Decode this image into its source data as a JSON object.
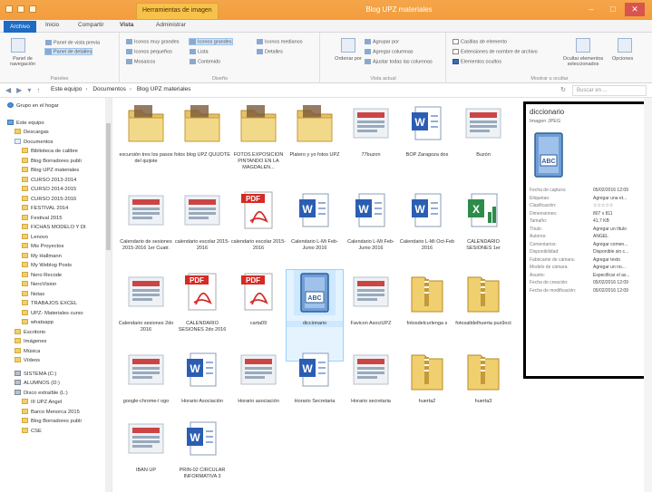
{
  "window": {
    "title": "Blog UPZ materiales",
    "context_tab": "Herramientas de imagen",
    "controls": [
      "–",
      "□",
      "✕"
    ]
  },
  "ribbon_tabs": [
    "Archivo",
    "Inicio",
    "Compartir",
    "Vista",
    "Administrar"
  ],
  "ribbon": {
    "panes": {
      "nav_pane": "Panel de navegación",
      "preview_pane": "Panel de vista previa",
      "details_pane": "Panel de detalles",
      "label": "Paneles"
    },
    "layout": {
      "items": [
        "Iconos muy grandes",
        "Iconos grandes",
        "Iconos medianos",
        "Iconos pequeños",
        "Lista",
        "Detalles",
        "Mosaicos",
        "Contenido"
      ],
      "label": "Diseño"
    },
    "current_view": {
      "sort": "Ordenar por",
      "group": "Agrupar por",
      "add_columns": "Agregar columnas",
      "fit_columns": "Ajustar todas las columnas",
      "label": "Vista actual"
    },
    "show_hide": {
      "checkboxes": "Casillas de elemento",
      "extensions": "Extensiones de nombre de archivo",
      "hidden": "Elementos ocultos",
      "hide_selected": "Ocultar elementos seleccionados",
      "options": "Opciones",
      "label": "Mostrar u ocultar"
    }
  },
  "address": {
    "crumbs": [
      "Este equipo",
      "Documentos",
      "Blog UPZ materiales"
    ],
    "search_placeholder": "Buscar en ...",
    "refresh": "↻"
  },
  "nav_items": [
    {
      "label": "Grupo en el hogar",
      "icon": "homegroup-icon",
      "indent": 0
    },
    {
      "label": "Este equipo",
      "icon": "computer-icon",
      "indent": 0
    },
    {
      "label": "Descargas",
      "icon": "folder-icon",
      "indent": 1
    },
    {
      "label": "Documentos",
      "icon": "documents-icon",
      "indent": 1
    },
    {
      "label": "Biblioteca de calibre",
      "icon": "folder-icon",
      "indent": 2
    },
    {
      "label": "Blog Borradores publi",
      "icon": "folder-icon",
      "indent": 2
    },
    {
      "label": "Blog UPZ materiales",
      "icon": "folder-icon",
      "indent": 2
    },
    {
      "label": "CURSO 2013-2014",
      "icon": "folder-icon",
      "indent": 2
    },
    {
      "label": "CURSO 2014-2015",
      "icon": "folder-icon",
      "indent": 2
    },
    {
      "label": "CURSO 2015-2016",
      "icon": "folder-icon",
      "indent": 2
    },
    {
      "label": "FESTIVAL 2014",
      "icon": "folder-icon",
      "indent": 2
    },
    {
      "label": "Festival 2015",
      "icon": "folder-icon",
      "indent": 2
    },
    {
      "label": "FICHAS MODELO Y DI",
      "icon": "folder-icon",
      "indent": 2
    },
    {
      "label": "Lenovo",
      "icon": "folder-icon",
      "indent": 2
    },
    {
      "label": "Mis Proyectos",
      "icon": "folder-icon",
      "indent": 2
    },
    {
      "label": "My Hallmann",
      "icon": "folder-icon",
      "indent": 2
    },
    {
      "label": "My Weblog Posts",
      "icon": "folder-icon",
      "indent": 2
    },
    {
      "label": "Nero Recode",
      "icon": "folder-icon",
      "indent": 2
    },
    {
      "label": "NeroVision",
      "icon": "folder-icon",
      "indent": 2
    },
    {
      "label": "Notas",
      "icon": "folder-icon",
      "indent": 2
    },
    {
      "label": "TRABAJOS EXCEL",
      "icon": "folder-icon",
      "indent": 2
    },
    {
      "label": "UPZ- Materiales curso",
      "icon": "folder-icon",
      "indent": 2
    },
    {
      "label": "whatsapp",
      "icon": "folder-icon",
      "indent": 2
    },
    {
      "label": "Escritorio",
      "icon": "folder-icon",
      "indent": 1
    },
    {
      "label": "Imágenes",
      "icon": "folder-icon",
      "indent": 1
    },
    {
      "label": "Música",
      "icon": "folder-icon",
      "indent": 1
    },
    {
      "label": "Vídeos",
      "icon": "folder-icon",
      "indent": 1
    },
    {
      "label": "SISTEMA (C:)",
      "icon": "drive-icon",
      "indent": 1
    },
    {
      "label": "ALUMNOS (D:)",
      "icon": "drive-icon",
      "indent": 1
    },
    {
      "label": "Disco extraíble (L:)",
      "icon": "drive-icon",
      "indent": 1
    },
    {
      "label": "III UPZ Angel",
      "icon": "folder-icon",
      "indent": 2
    },
    {
      "label": "Barco Menorca 2015",
      "icon": "folder-icon",
      "indent": 2
    },
    {
      "label": "Blog Borradores publi",
      "icon": "folder-icon",
      "indent": 2
    },
    {
      "label": "CSE",
      "icon": "folder-icon",
      "indent": 2
    }
  ],
  "files": [
    {
      "name": "excursión tres los pasos del quijote",
      "type": "folder"
    },
    {
      "name": "fotos blog UPZ QUIJOTE",
      "type": "folder"
    },
    {
      "name": "FOTOS EXPOSICION PINTANDO EN LA MAGDALEN...",
      "type": "folder"
    },
    {
      "name": "Platero y yo fotos UPZ",
      "type": "folder"
    },
    {
      "name": "77buzon",
      "type": "image"
    },
    {
      "name": "BOP Zaragoza dos",
      "type": "word"
    },
    {
      "name": "Buzón",
      "type": "image"
    },
    {
      "name": "Calendario de sesiones 2015-2016 1er Cuatr.",
      "type": "image"
    },
    {
      "name": "calendario escolar 2015-2016",
      "type": "image"
    },
    {
      "name": "calendario escolar 2015-2016",
      "type": "pdf"
    },
    {
      "name": "Calendario L-Mi Feb-Junio 2016",
      "type": "word"
    },
    {
      "name": "Calendario L-Mi Feb-Junio 2016",
      "type": "word"
    },
    {
      "name": "Calendario L-Mi Oct-Feb 2016",
      "type": "word"
    },
    {
      "name": "CALENDARIO SESIONES 1er",
      "type": "excel"
    },
    {
      "name": "Calendario sesiones 2do 2016",
      "type": "image"
    },
    {
      "name": "CALENDARIO SESIONES 2do 2016",
      "type": "pdf"
    },
    {
      "name": "carta09",
      "type": "pdf"
    },
    {
      "name": "diccionario",
      "type": "image-selected"
    },
    {
      "name": "Favicon AsociUPZ",
      "type": "image"
    },
    {
      "name": "fotosdelcurlenga s",
      "type": "zip"
    },
    {
      "name": "fotosaltdelhuerta pus9oct",
      "type": "zip"
    },
    {
      "name": "google-chrome-l ogo",
      "type": "image"
    },
    {
      "name": "Horario Asociación",
      "type": "word"
    },
    {
      "name": "Horario asociación",
      "type": "image"
    },
    {
      "name": "Horario Secretaria",
      "type": "word"
    },
    {
      "name": "Horario secretaria",
      "type": "image"
    },
    {
      "name": "huerta2",
      "type": "zip"
    },
    {
      "name": "huerta3",
      "type": "zip"
    },
    {
      "name": "IBAN UP",
      "type": "image"
    },
    {
      "name": "PRIN-02 CIRCULAR INFORMATIVA 3",
      "type": "word"
    }
  ],
  "details": {
    "name": "diccionario",
    "type": "Imagen JPEG",
    "props": [
      [
        "Fecha de captura:",
        "05/02/2016 12:09"
      ],
      [
        "Etiquetas:",
        "Agregar una et..."
      ],
      [
        "Clasificación:",
        "☆☆☆☆☆"
      ],
      [
        "Dimensiones:",
        "807 x 811"
      ],
      [
        "Tamaño:",
        "41,7 KB"
      ],
      [
        "Título:",
        "Agregar un título"
      ],
      [
        "Autores:",
        "ANGEL"
      ],
      [
        "Comentarios:",
        "Agregar comen..."
      ],
      [
        "Disponibilidad:",
        "Disponible sin c..."
      ],
      [
        "Fabricante de cámara:",
        "Agregar texto"
      ],
      [
        "Modelo de cámara:",
        "Agregar un no..."
      ],
      [
        "Asunto:",
        "Especificar el as..."
      ],
      [
        "Fecha de creación:",
        "05/02/2016 12:09"
      ],
      [
        "Fecha de modificación:",
        "05/02/2016 12:09"
      ]
    ]
  }
}
